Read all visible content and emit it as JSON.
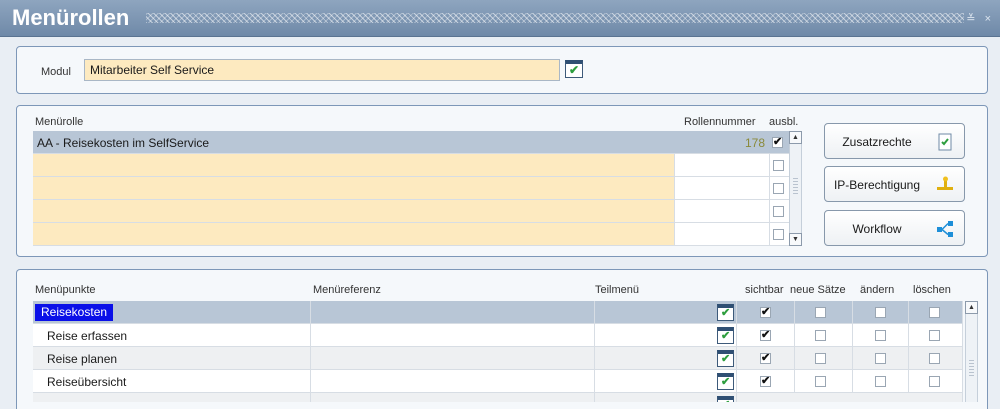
{
  "window": {
    "title": "Menürollen",
    "controls": "≚ ×"
  },
  "modul": {
    "label": "Modul",
    "value": "Mitarbeiter Self Service"
  },
  "rollen": {
    "col_menurolle": "Menürolle",
    "col_rollennummer": "Rollennummer",
    "col_ausbl": "ausbl.",
    "rows": [
      {
        "name": "AA - Reisekosten im SelfService",
        "nummer": "178",
        "ausbl": true
      },
      {
        "name": "",
        "nummer": "",
        "ausbl": false
      },
      {
        "name": "",
        "nummer": "",
        "ausbl": false
      },
      {
        "name": "",
        "nummer": "",
        "ausbl": false
      },
      {
        "name": "",
        "nummer": "",
        "ausbl": false
      }
    ],
    "buttons": {
      "zusatzrechte": "Zusatzrechte",
      "ip_berechtigung": "IP-Berechtigung",
      "workflow": "Workflow"
    }
  },
  "menupunkte": {
    "col_menupunkte": "Menüpunkte",
    "col_menureferenz": "Menüreferenz",
    "col_teilmenu": "Teilmenü",
    "col_sichtbar": "sichtbar",
    "col_neue_saetze": "neue Sätze",
    "col_aendern": "ändern",
    "col_loeschen": "löschen",
    "rows": [
      {
        "name": "Reisekosten",
        "sichtbar": true,
        "neue": false,
        "aendern": false,
        "loeschen": false,
        "selected": true
      },
      {
        "name": "Reise erfassen",
        "sichtbar": true,
        "neue": false,
        "aendern": false,
        "loeschen": false,
        "selected": false
      },
      {
        "name": "Reise planen",
        "sichtbar": true,
        "neue": false,
        "aendern": false,
        "loeschen": false,
        "selected": false
      },
      {
        "name": "Reiseübersicht",
        "sichtbar": true,
        "neue": false,
        "aendern": false,
        "loeschen": false,
        "selected": false
      }
    ]
  },
  "colors": {
    "accent_yellow": "#fdeac0",
    "selection_blue": "#0a10e8",
    "header_bar": "#7a93b1"
  }
}
